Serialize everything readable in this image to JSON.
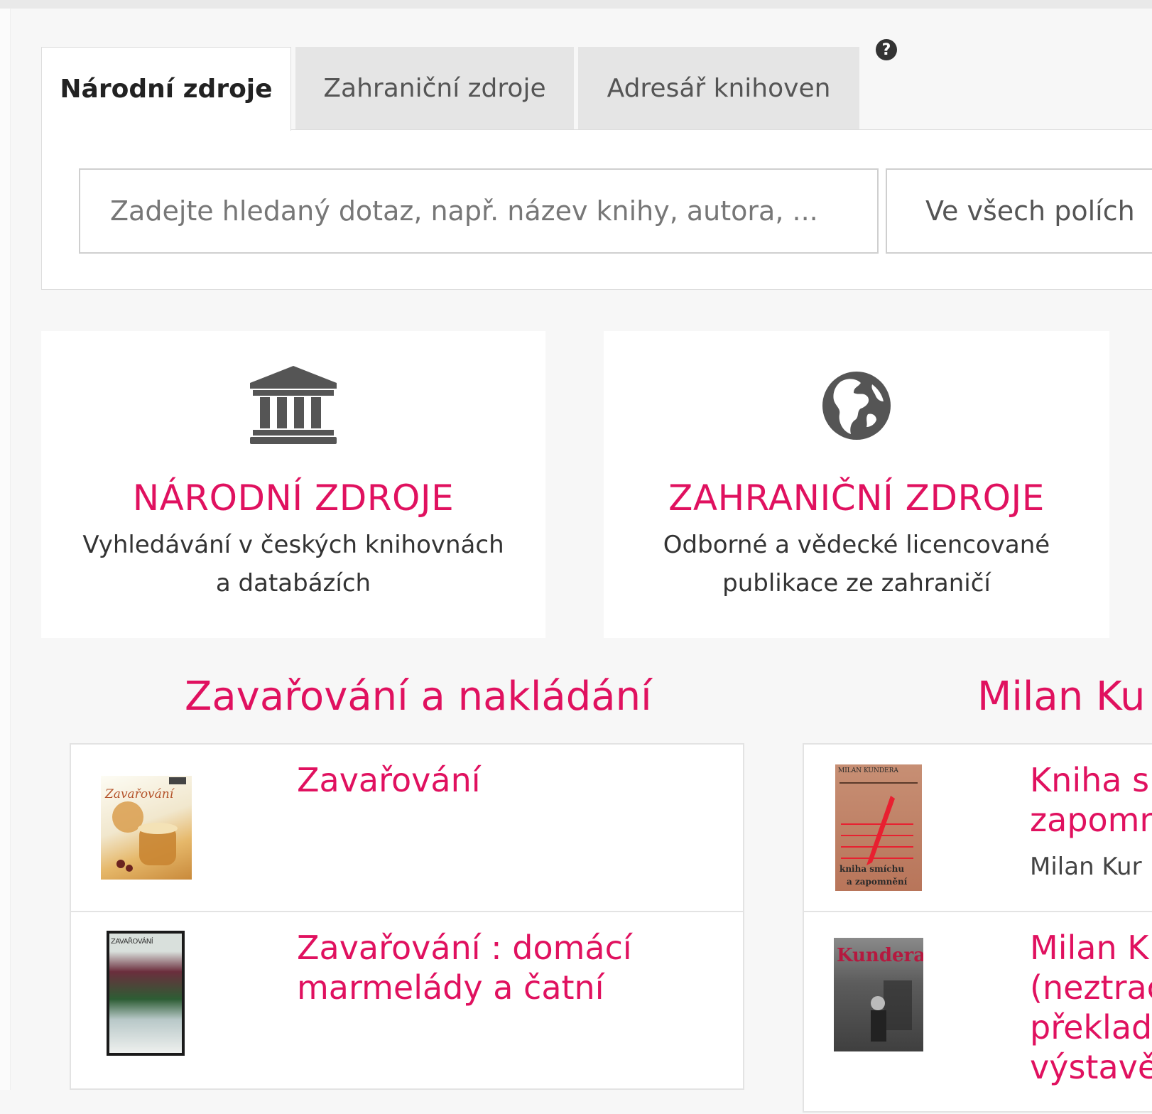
{
  "tabs": [
    {
      "label": "Národní zdroje",
      "active": true
    },
    {
      "label": "Zahraniční zdroje",
      "active": false
    },
    {
      "label": "Adresář knihoven",
      "active": false
    }
  ],
  "help_icon": "question-circle-icon",
  "search": {
    "placeholder": "Zadejte hledaný dotaz, např. název knihy, autora, ...",
    "field_select": "Ve všech polích"
  },
  "cards": [
    {
      "icon": "bank-icon",
      "title": "NÁRODNÍ ZDROJE",
      "desc_line1": "Vyhledávání v českých knihovnách",
      "desc_line2": "a databázích"
    },
    {
      "icon": "globe-icon",
      "title": "ZAHRANIČNÍ ZDROJE",
      "desc_line1": "Odborné a vědecké licencované",
      "desc_line2": "publikace ze zahraničí"
    }
  ],
  "sections": [
    {
      "title": "Zavařování a nakládání",
      "items": [
        {
          "title_line1": "Zavařování",
          "title_line2": "",
          "cover_text": "Zavařování"
        },
        {
          "title_line1": "Zavařování : domácí",
          "title_line2": "marmelády a čatní",
          "cover_text": "ZAVAŘOVÁNÍ"
        }
      ]
    },
    {
      "title": "Milan Ku",
      "items": [
        {
          "title_line1": "Kniha sı",
          "title_line2": "zapomn",
          "author": "Milan Kur",
          "cover_top": "MILAN KUNDERA",
          "cover_bottom_1": "kniha smíchu",
          "cover_bottom_2": "a zapomnění"
        },
        {
          "title_line1": "Milan K",
          "title_line2": "(neztrac",
          "title_line3": "překlade",
          "title_line4": "výstavě",
          "cover_text": "Kundera"
        }
      ]
    }
  ],
  "colors": {
    "accent": "#e0115f",
    "icon": "#555555"
  }
}
